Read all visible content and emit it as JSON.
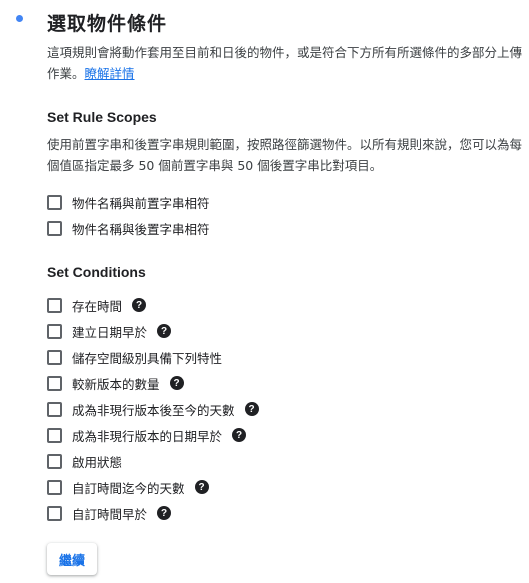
{
  "title": "選取物件條件",
  "description": {
    "text": "這項規則會將動作套用至目前和日後的物件，或是符合下方所有所選條件的多部分上傳作業。",
    "link": "瞭解詳情"
  },
  "scopes": {
    "title": "Set Rule Scopes",
    "description": "使用前置字串和後置字串規則範圍，按照路徑篩選物件。以所有規則來說，您可以為每個值區指定最多 50 個前置字串與 50 個後置字串比對項目。",
    "options": [
      {
        "label": "物件名稱與前置字串相符",
        "help": false
      },
      {
        "label": "物件名稱與後置字串相符",
        "help": false
      }
    ]
  },
  "conditions": {
    "title": "Set Conditions",
    "options": [
      {
        "label": "存在時間",
        "help": true
      },
      {
        "label": "建立日期早於",
        "help": true
      },
      {
        "label": "儲存空間級別具備下列特性",
        "help": false
      },
      {
        "label": "較新版本的數量",
        "help": true
      },
      {
        "label": "成為非現行版本後至今的天數",
        "help": true
      },
      {
        "label": "成為非現行版本的日期早於",
        "help": true
      },
      {
        "label": "啟用狀態",
        "help": false
      },
      {
        "label": "自訂時間迄今的天數",
        "help": true
      },
      {
        "label": "自訂時間早於",
        "help": true
      }
    ]
  },
  "help_icon": {
    "name": "help-circle-icon",
    "glyph": "?"
  },
  "continue_label": "繼續",
  "colors": {
    "accent": "#1a73e8",
    "step_dot": "#4285f4",
    "text": "#202124"
  }
}
